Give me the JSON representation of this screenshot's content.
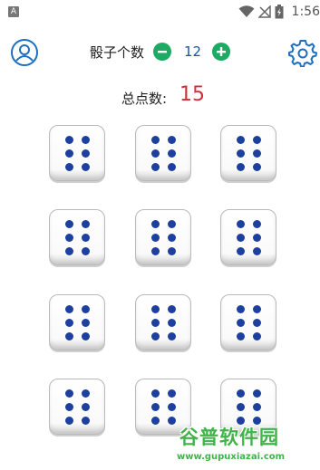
{
  "status_bar": {
    "app_letter": "A",
    "time": "1:56",
    "icons": [
      "wifi-icon",
      "no-signal-icon",
      "battery-icon"
    ]
  },
  "header": {
    "dice_count_label": "骰子个数",
    "dice_count_value": "12",
    "minus_symbol": "−",
    "plus_symbol": "+"
  },
  "total": {
    "label": "总点数:",
    "value": "15"
  },
  "dice": [
    {
      "face": 6
    },
    {
      "face": 6
    },
    {
      "face": 6
    },
    {
      "face": 6
    },
    {
      "face": 6
    },
    {
      "face": 6
    },
    {
      "face": 6
    },
    {
      "face": 6
    },
    {
      "face": 6
    },
    {
      "face": 6
    },
    {
      "face": 6
    },
    {
      "face": 6
    }
  ],
  "watermark": {
    "title": "谷普软件园",
    "url": "www.gupuxiazai.com"
  },
  "colors": {
    "accent_blue": "#1d6fc2",
    "green_button": "#1daa62",
    "total_red": "#d0303a",
    "pip_blue": "#1d3f9e",
    "watermark_green": "#41b34a"
  }
}
